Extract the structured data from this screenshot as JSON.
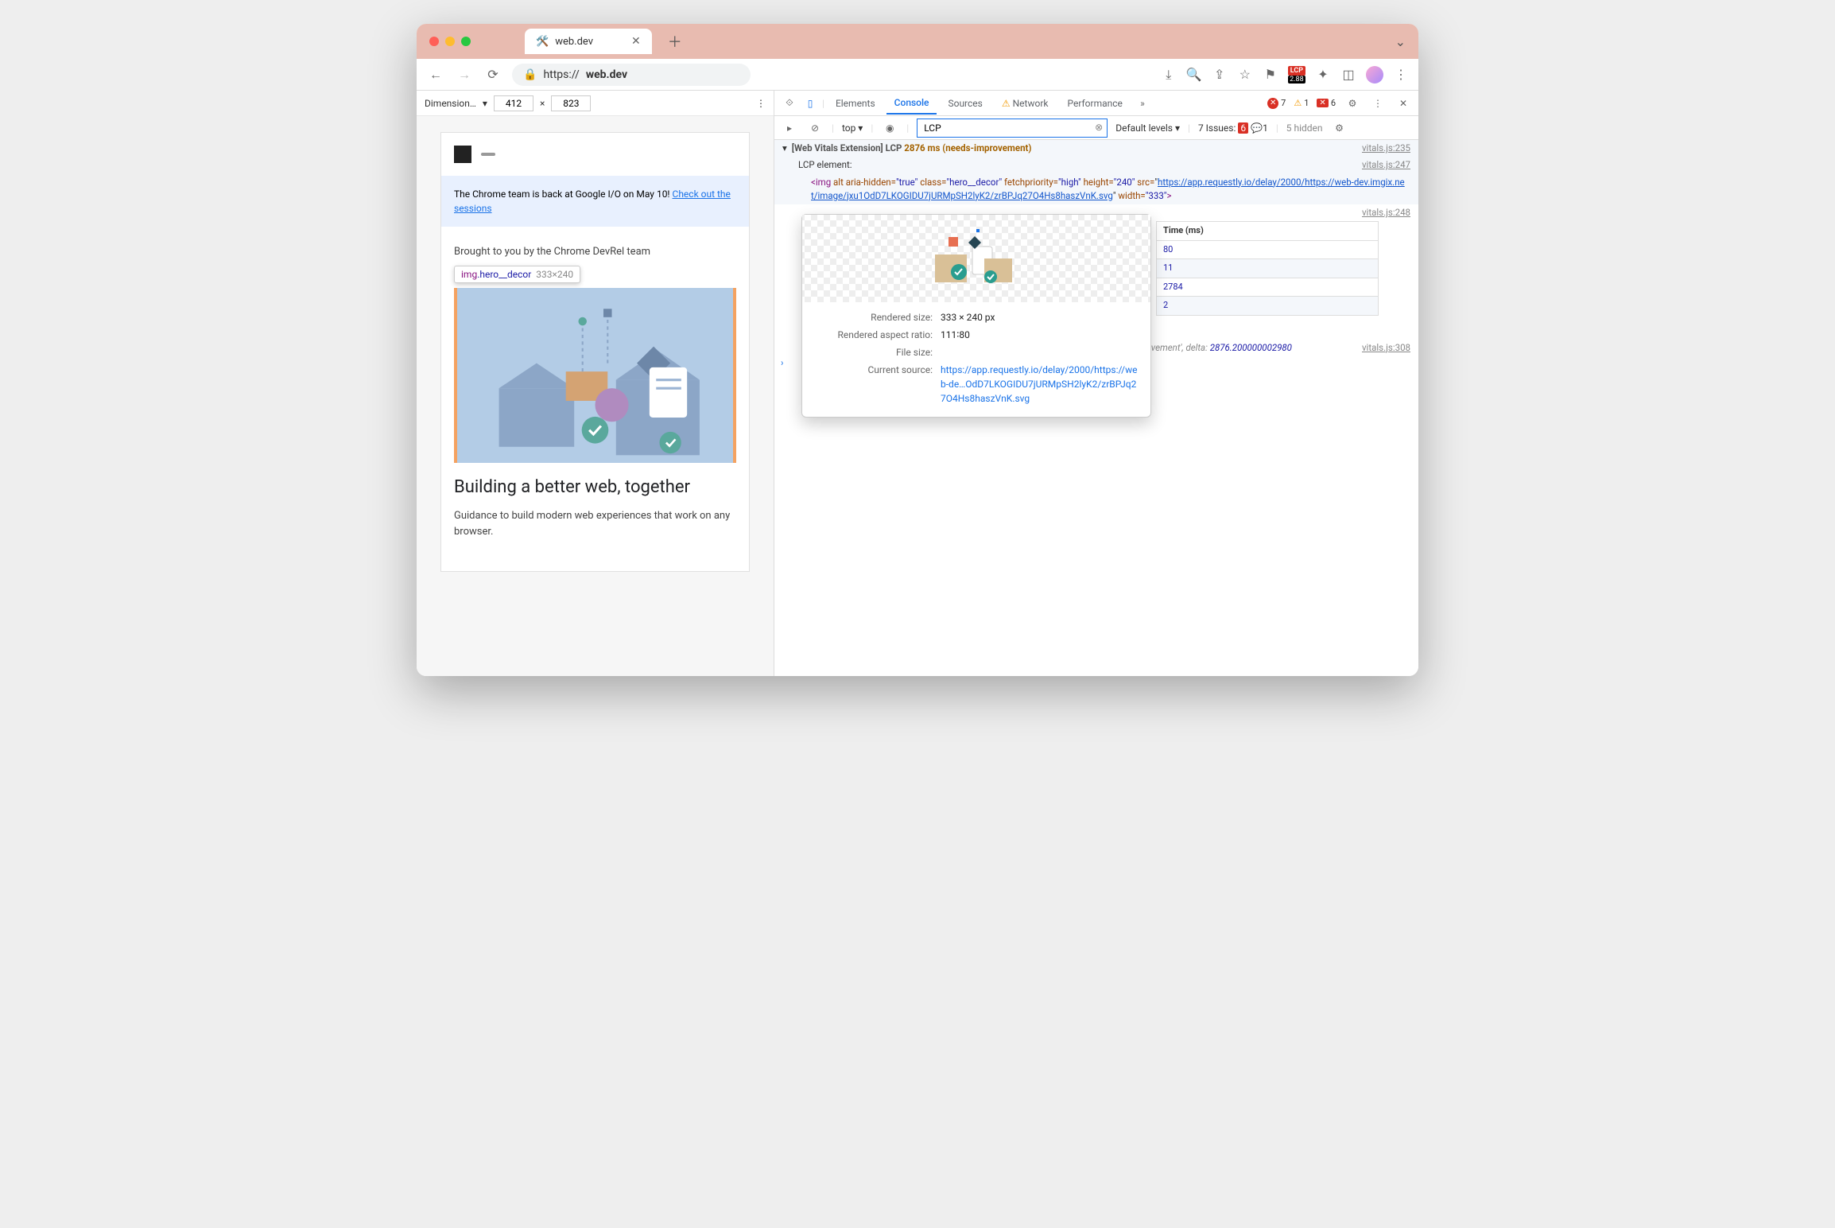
{
  "tab": {
    "title": "web.dev"
  },
  "url": {
    "scheme": "https://",
    "host": "web.dev"
  },
  "ext": {
    "lcp_label": "LCP",
    "lcp_value": "2.88"
  },
  "dimbar": {
    "label": "Dimension…",
    "w": "412",
    "x": "×",
    "h": "823"
  },
  "page": {
    "banner_text": "The Chrome team is back at Google I/O on May 10! ",
    "banner_link": "Check out the sessions",
    "sub": "Brought to you by the Chrome DevRel team",
    "tooltip_sel": "img",
    "tooltip_cls": ".hero__decor",
    "tooltip_dim": "333×240",
    "h1": "Building a better web, together",
    "p": "Guidance to build modern web experiences that work on any browser."
  },
  "dt": {
    "tabs": [
      "Elements",
      "Console",
      "Sources",
      "Network",
      "Performance"
    ],
    "errors": "7",
    "warnings": "1",
    "blocked": "6",
    "filter": "LCP",
    "ctx": "top",
    "levels": "Default levels",
    "issues_label": "7 Issues:",
    "issues_err": "6",
    "issues_msg": "1",
    "hidden": "5 hidden"
  },
  "log1": {
    "pre": "[Web Vitals Extension] LCP ",
    "ms": "2876 ms (needs-improvement)",
    "src": "vitals.js:235"
  },
  "log2": {
    "txt": "LCP element:",
    "src": "vitals.js:247"
  },
  "img_html": {
    "tag_open": "<img",
    "a1": " alt ",
    "a2": "aria-hidden=",
    "v2": "\"true\"",
    "a3": " class=",
    "v3": "\"hero__decor\"",
    "a4": " fetchpriority=",
    "v4": "\"high\"",
    "a5": " height=",
    "v5": "\"240\"",
    "a6": " src=",
    "url1": "https://app.requestly.io/delay/2000/https://web-dev.imgix.net/image/jxu1OdD7LKOGIDU7jURMpSH2lyK2/zrBPJq27O4Hs8haszVnK.svg",
    "a7": " width=",
    "v7": "\"333\"",
    "close": ">"
  },
  "log3_src": "vitals.js:248",
  "table": {
    "th_time": "Time (ms)",
    "rows": [
      "80",
      "11",
      "2784",
      "2"
    ]
  },
  "log4": {
    "src": "vitals.js:308",
    "tail1": "provement'",
    "tail2": ", delta: ",
    "delta": "2876.200000002980"
  },
  "popup": {
    "rendered_label": "Rendered size:",
    "rendered": "333 × 240 px",
    "ratio_label": "Rendered aspect ratio:",
    "ratio": "111∶80",
    "filesize_label": "File size:",
    "source_label": "Current source:",
    "source": "https://app.requestly.io/delay/2000/https://web-de…OdD7LKOGIDU7jURMpSH2lyK2/zrBPJq27O4Hs8haszVnK.svg"
  }
}
